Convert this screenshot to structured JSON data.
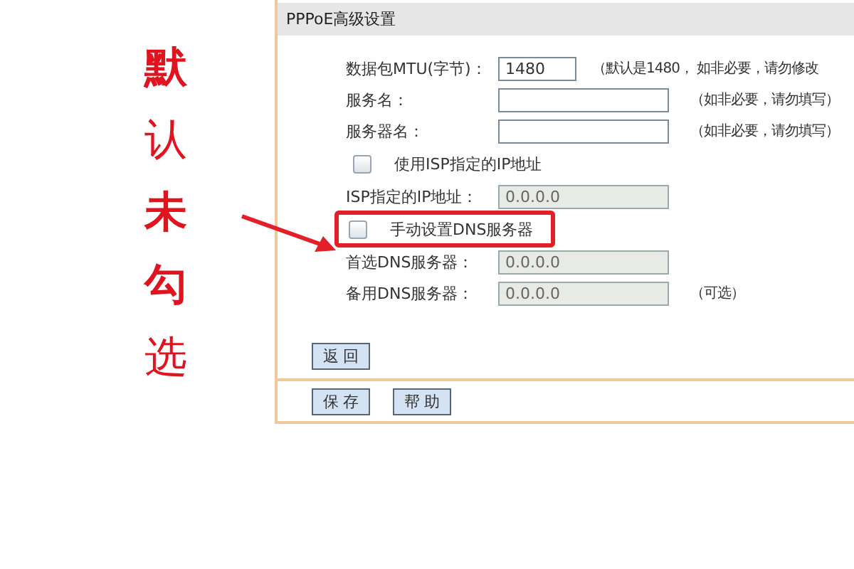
{
  "annotation": {
    "text": "**默**认**未勾**选"
  },
  "panel": {
    "title": "PPPoE高级设置",
    "rows": [
      {
        "kind": "text",
        "label": "数据包MTU(字节)：",
        "value": "1480",
        "disabled": false,
        "short": true,
        "hint": "（默认是1480， 如非必要，请勿修改"
      },
      {
        "kind": "text",
        "label": "服务名：",
        "disabled": false,
        "short": false,
        "hint": "（如非必要，请勿填写）"
      },
      {
        "kind": "text",
        "label": "服务器名：",
        "disabled": false,
        "short": false,
        "hint": "（如非必要，请勿填写）"
      },
      {
        "kind": "checkbox",
        "label": "使用ISP指定的IP地址",
        "checked": false,
        "highlighted": false
      },
      {
        "kind": "text",
        "label": "ISP指定的IP地址：",
        "value": "0.0.0.0",
        "disabled": true,
        "short": false
      },
      {
        "kind": "checkbox",
        "label": "手动设置DNS服务器",
        "checked": false,
        "highlighted": true
      },
      {
        "kind": "text",
        "label": "首选DNS服务器：",
        "value": "0.0.0.0",
        "disabled": true,
        "short": false
      },
      {
        "kind": "text",
        "label": "备用DNS服务器：",
        "value": "0.0.0.0",
        "disabled": true,
        "short": false,
        "hint": "（可选）"
      }
    ],
    "back_button": "返回",
    "buttons": [
      "保存",
      "帮助"
    ]
  }
}
